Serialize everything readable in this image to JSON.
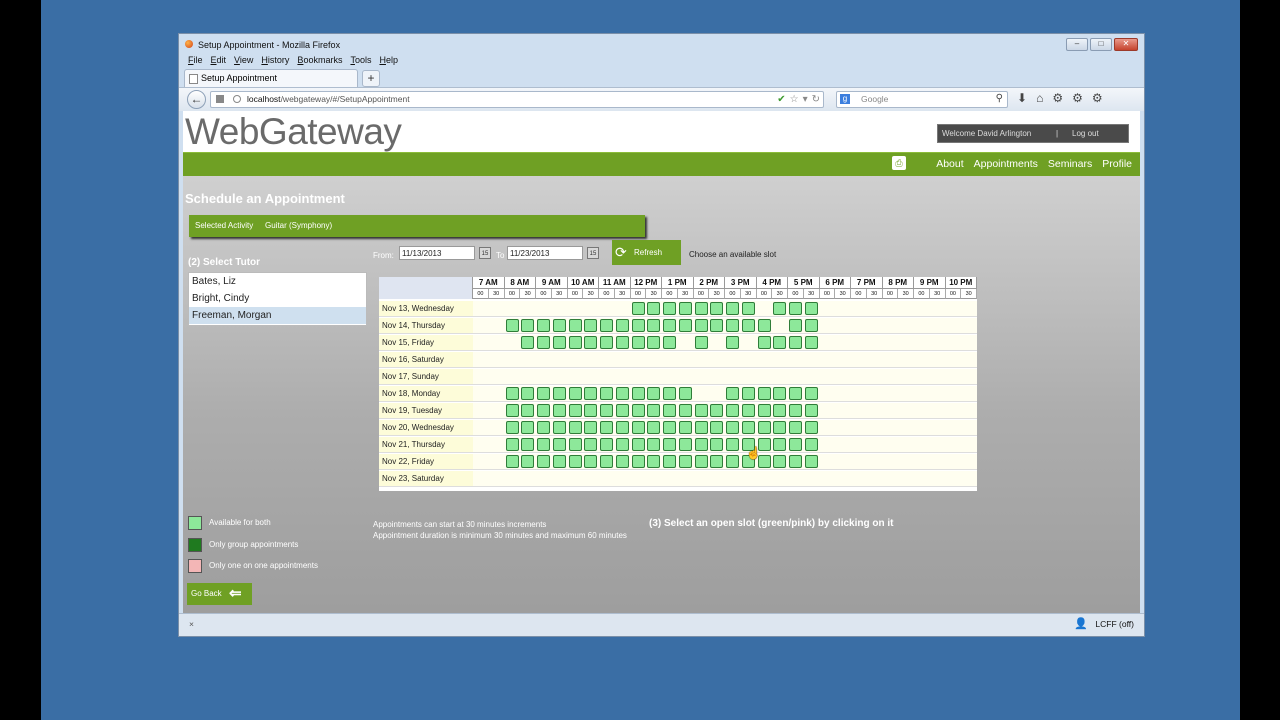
{
  "window": {
    "title": "Setup Appointment - Mozilla Firefox"
  },
  "menu": [
    "File",
    "Edit",
    "View",
    "History",
    "Bookmarks",
    "Tools",
    "Help"
  ],
  "tab": {
    "label": "Setup Appointment",
    "new_tab": "+"
  },
  "address": {
    "host": "localhost",
    "path": "/webgateway/#/SetupAppointment"
  },
  "search": {
    "placeholder": "Google"
  },
  "site": {
    "logo": "WebGateway",
    "welcome": "Welcome David Arlington",
    "separator": "|",
    "logout": "Log out",
    "nav": [
      "About",
      "Appointments",
      "Seminars",
      "Profile"
    ]
  },
  "page": {
    "title": "Schedule an Appointment",
    "activity_label": "Selected Activity",
    "activity_value": "Guitar (Symphony)",
    "select_tutor": "(2) Select Tutor",
    "tutors": [
      {
        "name": "Bates, Liz",
        "selected": false
      },
      {
        "name": "Bright, Cindy",
        "selected": false
      },
      {
        "name": "Freeman, Morgan",
        "selected": true
      }
    ],
    "from_label": "From:",
    "from_value": "11/13/2013",
    "to_label": "To",
    "to_value": "11/23/2013",
    "cal_icon": "15",
    "refresh_label": "Refresh",
    "choose_label": "Choose an available slot",
    "step3": "(3) Select an open slot (green/pink) by clicking on it",
    "notes": [
      "Appointments can start at 30 minutes increments",
      "Appointment duration is minimum 30 minutes and maximum 60 minutes"
    ],
    "legend": [
      {
        "label": "Available for both",
        "color": "#8de89a"
      },
      {
        "label": "Only group appointments",
        "color": "#1f7a1f"
      },
      {
        "label": "Only one on one appointments",
        "color": "#f3b6b6"
      }
    ],
    "go_back": "Go Back"
  },
  "schedule": {
    "hours": [
      "7 AM",
      "8 AM",
      "9 AM",
      "10 AM",
      "11 AM",
      "12 PM",
      "1 PM",
      "2 PM",
      "3 PM",
      "4 PM",
      "5 PM",
      "6 PM",
      "7 PM",
      "8 PM",
      "9 PM",
      "10 PM"
    ],
    "subslots": [
      "00",
      "30"
    ],
    "days": [
      {
        "label": "Nov 13, Wednesday",
        "available": [
          10,
          11,
          12,
          13,
          14,
          15,
          16,
          17,
          19,
          20,
          21
        ]
      },
      {
        "label": "Nov 14, Thursday",
        "available": [
          2,
          3,
          4,
          5,
          6,
          7,
          8,
          9,
          10,
          11,
          12,
          13,
          14,
          15,
          16,
          17,
          18,
          20,
          21
        ]
      },
      {
        "label": "Nov 15, Friday",
        "available": [
          3,
          4,
          5,
          6,
          7,
          8,
          9,
          10,
          11,
          12,
          14,
          16,
          18,
          19,
          20,
          21
        ]
      },
      {
        "label": "Nov 16, Saturday",
        "available": []
      },
      {
        "label": "Nov 17, Sunday",
        "available": []
      },
      {
        "label": "Nov 18, Monday",
        "available": [
          2,
          3,
          4,
          5,
          6,
          7,
          8,
          9,
          10,
          11,
          12,
          13,
          16,
          17,
          18,
          19,
          20,
          21
        ]
      },
      {
        "label": "Nov 19, Tuesday",
        "available": [
          2,
          3,
          4,
          5,
          6,
          7,
          8,
          9,
          10,
          11,
          12,
          13,
          14,
          15,
          16,
          17,
          18,
          19,
          20,
          21
        ]
      },
      {
        "label": "Nov 20, Wednesday",
        "available": [
          2,
          3,
          4,
          5,
          6,
          7,
          8,
          9,
          10,
          11,
          12,
          13,
          14,
          15,
          16,
          17,
          18,
          19,
          20,
          21
        ]
      },
      {
        "label": "Nov 21, Thursday",
        "available": [
          2,
          3,
          4,
          5,
          6,
          7,
          8,
          9,
          10,
          11,
          12,
          13,
          14,
          15,
          16,
          17,
          18,
          19,
          20,
          21
        ]
      },
      {
        "label": "Nov 22, Friday",
        "available": [
          2,
          3,
          4,
          5,
          6,
          7,
          8,
          9,
          10,
          11,
          12,
          13,
          14,
          15,
          16,
          17,
          18,
          19,
          20,
          21
        ]
      },
      {
        "label": "Nov 23, Saturday",
        "available": []
      }
    ]
  },
  "status": {
    "close": "×",
    "lcff": "LCFF (off)"
  }
}
